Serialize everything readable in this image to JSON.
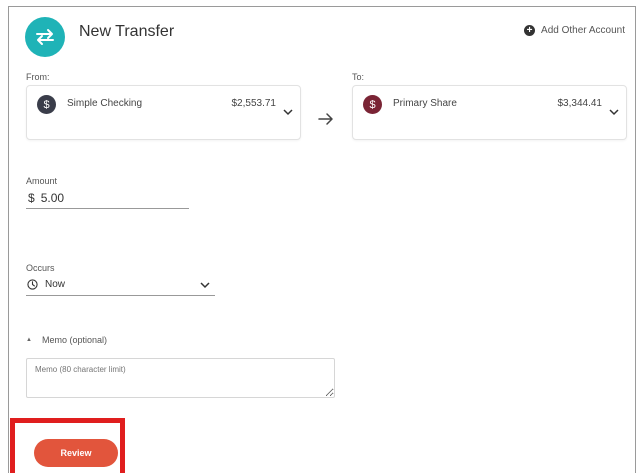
{
  "header": {
    "title": "New Transfer",
    "add_account_label": "Add Other Account"
  },
  "from": {
    "label": "From:",
    "account_name": "Simple Checking",
    "balance": "$2,553.71",
    "icon_color": "#3a3d4a"
  },
  "to": {
    "label": "To:",
    "account_name": "Primary Share",
    "balance": "$3,344.41",
    "icon_color": "#7a2435"
  },
  "amount": {
    "label": "Amount",
    "currency": "$",
    "value": "5.00"
  },
  "occurs": {
    "label": "Occurs",
    "value": "Now"
  },
  "memo": {
    "toggle_label": "Memo (optional)",
    "placeholder": "Memo (80 character limit)"
  },
  "actions": {
    "review_label": "Review"
  },
  "colors": {
    "brand_teal": "#1fb3b7",
    "review_button": "#e2553c",
    "highlight_box": "#e01e1e"
  }
}
